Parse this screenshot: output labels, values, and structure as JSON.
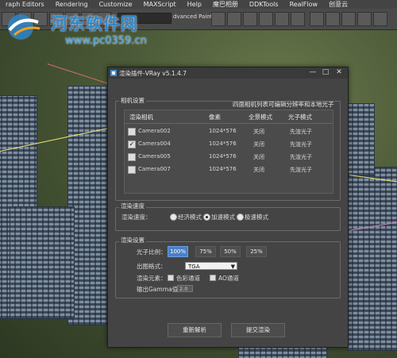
{
  "menubar": {
    "items": [
      "raph Editors",
      "Rendering",
      "Customize",
      "MAXScript",
      "Help",
      "魔巴相册",
      "DDKTools",
      "RealFlow",
      "创意云"
    ]
  },
  "toolbar": {
    "advanced_label": "dvanced Paint"
  },
  "watermark": {
    "title": "河东软件网",
    "url": "www.pc0359.cn"
  },
  "window": {
    "title": "渲染插件-VRay v5.1.4.7",
    "controls": {
      "minimize": "—",
      "maximize": "□",
      "close": "✕"
    }
  },
  "camera_settings": {
    "group_title": "相机设置",
    "hint": "四面相机列表可编辑分辨率和本地光子",
    "columns": [
      "渲染相机",
      "像素",
      "全景模式",
      "光子模式"
    ],
    "rows": [
      {
        "checked": false,
        "name": "Camera002",
        "pixels": "1024*576",
        "panorama": "关闭",
        "photon": "先渲光子"
      },
      {
        "checked": true,
        "name": "Camera004",
        "pixels": "1024*576",
        "panorama": "关闭",
        "photon": "先渲光子"
      },
      {
        "checked": false,
        "name": "Camera005",
        "pixels": "1024*576",
        "panorama": "关闭",
        "photon": "先渲光子"
      },
      {
        "checked": false,
        "name": "Camera007",
        "pixels": "1024*576",
        "panorama": "关闭",
        "photon": "先渲光子"
      }
    ]
  },
  "render_speed": {
    "group_title": "渲染速度",
    "label": "渲染速度：",
    "options": [
      "经济模式",
      "加速模式",
      "极速模式"
    ],
    "selected": "加速模式"
  },
  "render_settings": {
    "group_title": "渲染设置",
    "photon_ratio_label": "光子比例：",
    "photon_ratios": [
      "100%",
      "75%",
      "50%",
      "25%"
    ],
    "photon_ratio_selected": "100%",
    "format_label": "出图格式：",
    "format_value": "TGA",
    "elements_label": "渲染元素：",
    "element_color": "色彩通道",
    "element_ao": "AO通道",
    "gamma_label": "输出Gamma值：",
    "gamma_value": "2.0"
  },
  "actions": {
    "reparse": "重新解析",
    "submit": "提交渲染"
  },
  "colors": {
    "accent": "#4a7fc8",
    "window_bg": "#444444",
    "watermark": "#2f86c8"
  }
}
